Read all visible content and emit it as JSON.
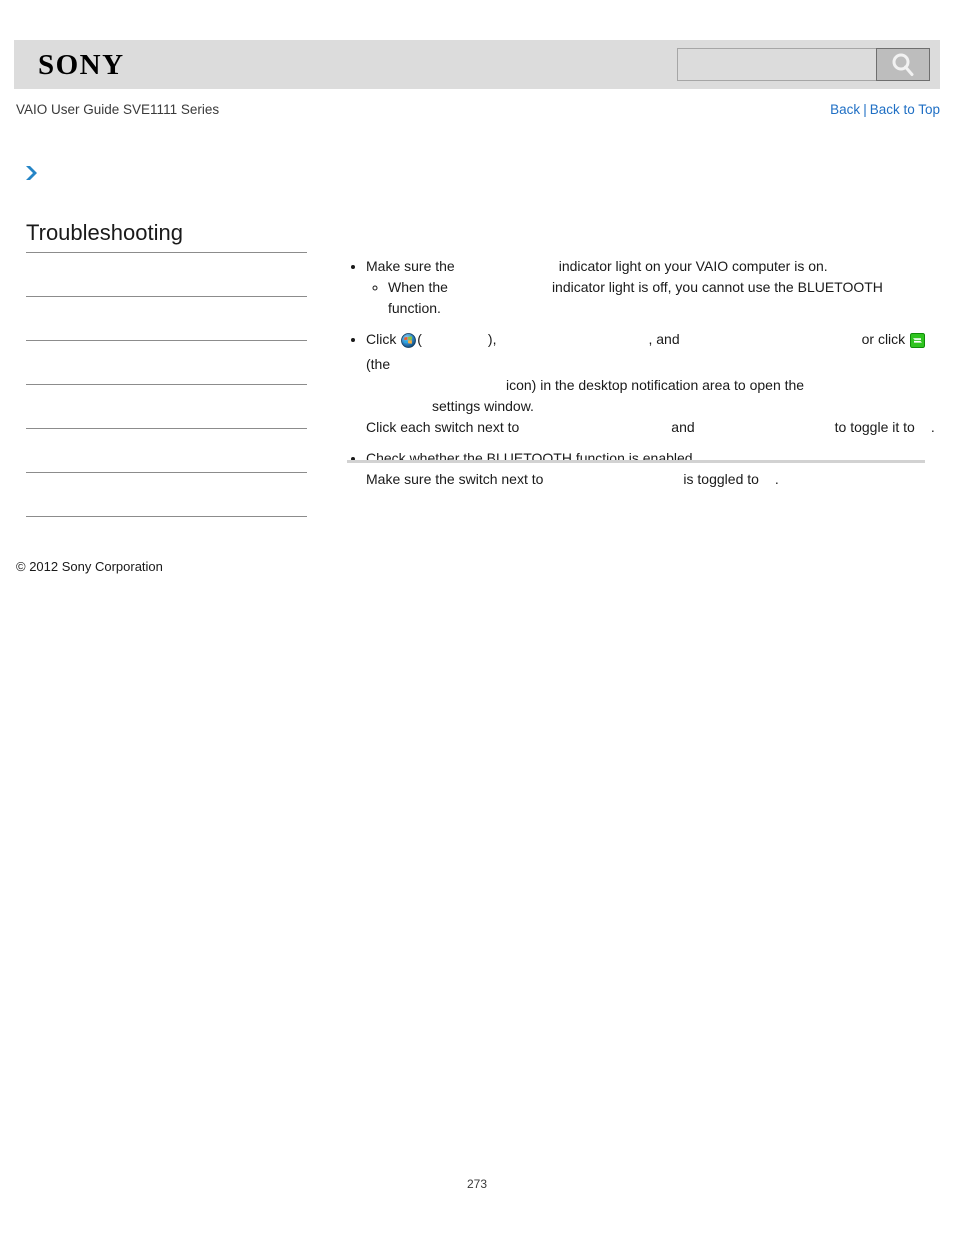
{
  "header": {
    "logo_text": "SONY",
    "search": {
      "value": "",
      "placeholder": "",
      "icon": "search-icon",
      "button_label": ""
    },
    "background_color": "#dcdcdc"
  },
  "subheader": {
    "guide_title": "VAIO User Guide SVE1111 Series",
    "links": [
      {
        "label": "Back"
      },
      {
        "label": "Back to Top"
      }
    ],
    "separator": "|",
    "link_color": "#1f6fc4"
  },
  "breadcrumb": {
    "icon": "chevron-right-icon",
    "label": ""
  },
  "sidebar": {
    "heading": "Troubleshooting",
    "items": [
      {
        "label": ""
      },
      {
        "label": ""
      },
      {
        "label": ""
      },
      {
        "label": ""
      },
      {
        "label": ""
      },
      {
        "label": ""
      }
    ]
  },
  "content": {
    "bullets": [
      {
        "text_a": "Make sure the",
        "text_b": "indicator light on your VAIO computer is on.",
        "sub": {
          "text_a": "When the",
          "text_b": "indicator light is off, you cannot use the BLUETOOTH function."
        }
      },
      {
        "line1_a": "Click",
        "line1_icon": "windows-start-orb-icon",
        "line1_b": "(",
        "line1_c": "),",
        "line1_d": ", and",
        "line1_e": "or click",
        "line1_icon2": "vaio-wireless-switch-icon",
        "line1_f": "(the",
        "line2_a": "icon) in the desktop notification area to open the",
        "line3_a": "settings window.",
        "line4_a": "Click each switch next to",
        "line4_b": "and",
        "line4_c": "to toggle it to",
        "line4_d": "."
      },
      {
        "line1": "Check whether the BLUETOOTH function is enabled.",
        "line2_a": "Make sure the switch next to",
        "line2_b": "is toggled to",
        "line2_c": "."
      }
    ]
  },
  "footer": {
    "copyright": "© 2012 Sony Corporation",
    "page_number": "273"
  }
}
